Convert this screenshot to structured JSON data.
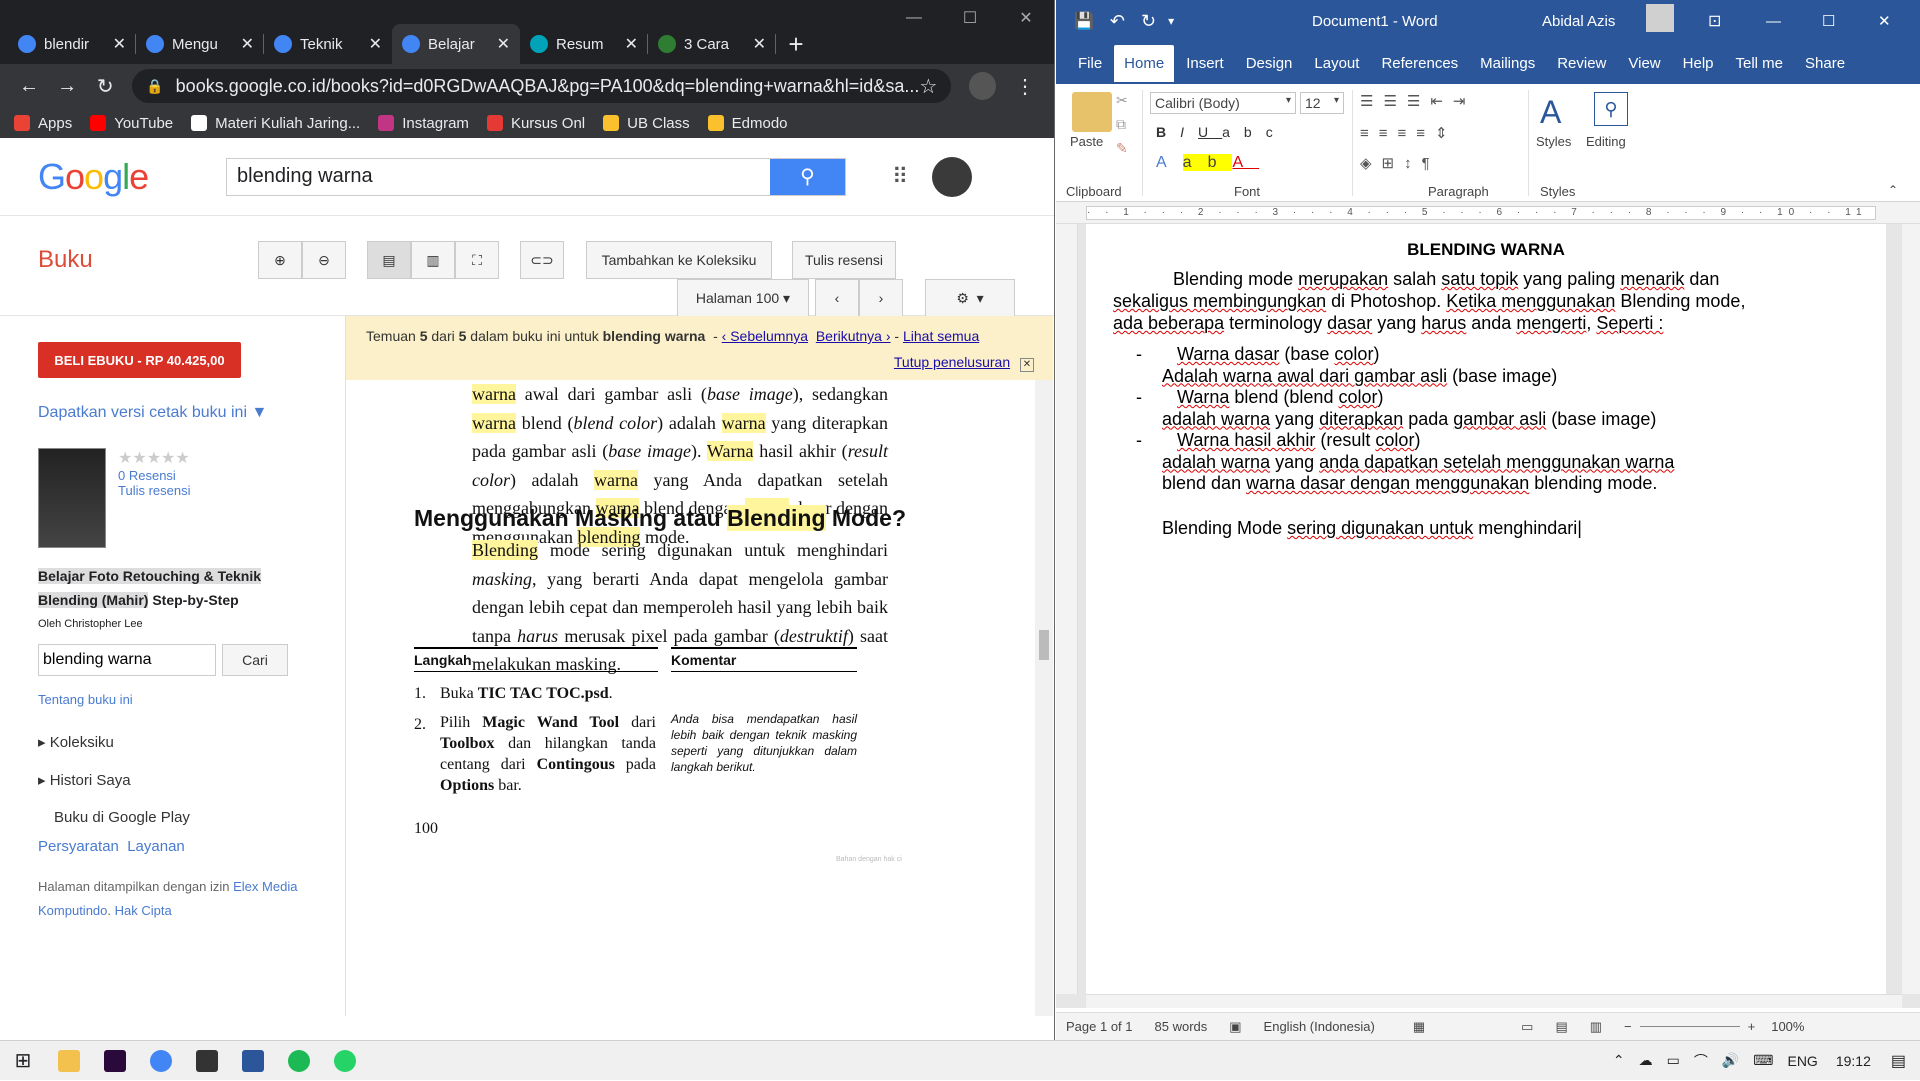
{
  "chrome": {
    "tabs": [
      {
        "title": "blendir",
        "color": "#4285f4"
      },
      {
        "title": "Mengu",
        "color": "#4285f4"
      },
      {
        "title": "Teknik",
        "color": "#4285f4"
      },
      {
        "title": "Belajar",
        "color": "#4285f4"
      },
      {
        "title": "Resum",
        "color": "#00a3b8"
      },
      {
        "title": "3 Cara",
        "color": "#2e7d32"
      }
    ],
    "url": "books.google.co.id/books?id=d0RGDwAAQBAJ&pg=PA100&dq=blending+warna&hl=id&sa...",
    "bookmarks": [
      {
        "label": "Apps",
        "color": "#ea4335"
      },
      {
        "label": "YouTube",
        "color": "#ff0000"
      },
      {
        "label": "Materi Kuliah Jaring...",
        "color": "#ffffff"
      },
      {
        "label": "Instagram",
        "color": "#c13584"
      },
      {
        "label": "Kursus Onl",
        "color": "#e53935"
      },
      {
        "label": "UB Class",
        "color": "#fbc02d"
      },
      {
        "label": "Edmodo",
        "color": "#fbc02d"
      }
    ]
  },
  "books": {
    "search_value": "blending warna",
    "section": "Buku",
    "btn_add": "Tambahkan ke Koleksiku",
    "btn_review": "Tulis resensi",
    "page_select": "Halaman 100",
    "buy": "BELI EBUKU - RP 40.425,00",
    "print_version": "Dapatkan versi cetak buku ini ▼",
    "reviews_count": "0 Resensi",
    "write_review": "Tulis resensi",
    "book_title_a": "Belajar Foto Retouching & Teknik",
    "book_title_b": "Blending (Mahir)",
    "book_title_c": " Step-by-Step",
    "author": "Oleh Christopher Lee",
    "in_book_search": "blending warna",
    "search_btn": "Cari",
    "about": "Tentang buku ini",
    "koleksi": "Koleksiku",
    "histori": "Histori Saya",
    "play": "Buku di Google Play",
    "terms": "Persyaratan",
    "service": "Layanan",
    "permission_a": "Halaman ditampilkan dengan izin ",
    "permission_publisher": "Elex Media Komputindo",
    "permission_b": ". ",
    "copyright": "Hak Cipta",
    "notice_a": "Temuan ",
    "notice_b": "5",
    "notice_c": " dari ",
    "notice_d": "5",
    "notice_e": " dalam buku ini untuk ",
    "notice_f": "blending warna",
    "notice_prev": "‹ Sebelumnya",
    "notice_next": "Berikutnya ›",
    "notice_all": "Lihat semua",
    "notice_close": "Tutup penelusuran",
    "page_heading_a": "Menggunakan Masking atau ",
    "page_heading_b": "Blending",
    "page_heading_c": " Mode?",
    "col_langkah": "Langkah",
    "col_komentar": "Komentar",
    "step1_num": "1.",
    "step1_a": "Buka ",
    "step1_b": "TIC TAC TOC.psd",
    "step1_c": ".",
    "step2_num": "2.",
    "comment": "Anda bisa mendapatkan hasil lebih baik dengan teknik masking seperti yang ditunjukkan dalam langkah berikut.",
    "page_number": "100",
    "footer_small": "Bahan dengan hak ci"
  },
  "word": {
    "doc_title": "Document1 - Word",
    "user": "Abidal Azis",
    "tabs": [
      "File",
      "Home",
      "Insert",
      "Design",
      "Layout",
      "References",
      "Mailings",
      "Review",
      "View",
      "Help",
      "Tell me",
      "Share"
    ],
    "font": "Calibri (Body)",
    "size": "12",
    "paste": "Paste",
    "styles": "Styles",
    "editing": "Editing",
    "group_clipboard": "Clipboard",
    "group_font": "Font",
    "group_paragraph": "Paragraph",
    "group_styles": "Styles",
    "heading": "BLENDING WARNA",
    "status_page": "Page 1 of 1",
    "status_words": "85 words",
    "status_lang": "English (Indonesia)",
    "zoom": "100%"
  },
  "taskbar": {
    "lang": "ENG",
    "time": "19:12"
  }
}
